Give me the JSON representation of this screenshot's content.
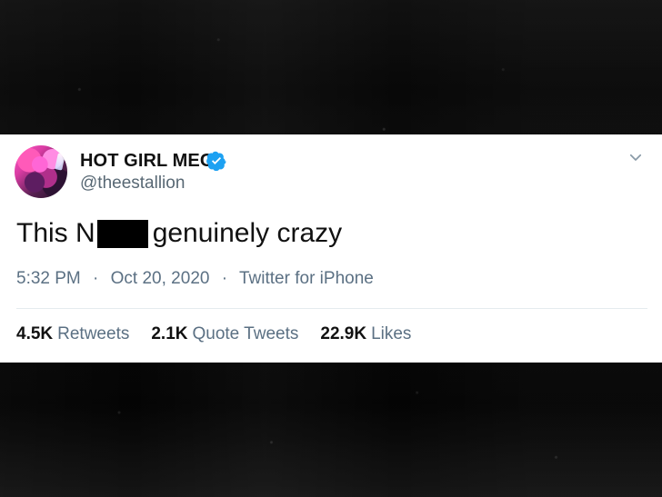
{
  "tweet": {
    "display_name": "HOT GIRL MEG",
    "handle": "@theestallion",
    "text_prefix": "This N",
    "text_suffix": "genuinely crazy",
    "timestamp": "5:32 PM",
    "date": "Oct 20, 2020",
    "source": "Twitter for iPhone",
    "separator": "·"
  },
  "stats": [
    {
      "count": "4.5K",
      "label": "Retweets"
    },
    {
      "count": "2.1K",
      "label": "Quote Tweets"
    },
    {
      "count": "22.9K",
      "label": "Likes"
    }
  ],
  "colors": {
    "verified": "#1DA1F2",
    "primary_text": "#111111",
    "secondary_text": "#5B7083",
    "divider": "#E5EBEF",
    "card_background": "#FFFFFF",
    "page_background": "#050505"
  },
  "icons": {
    "verified": "verified-badge-icon",
    "menu": "chevron-down-icon",
    "avatar": "profile-photo"
  }
}
